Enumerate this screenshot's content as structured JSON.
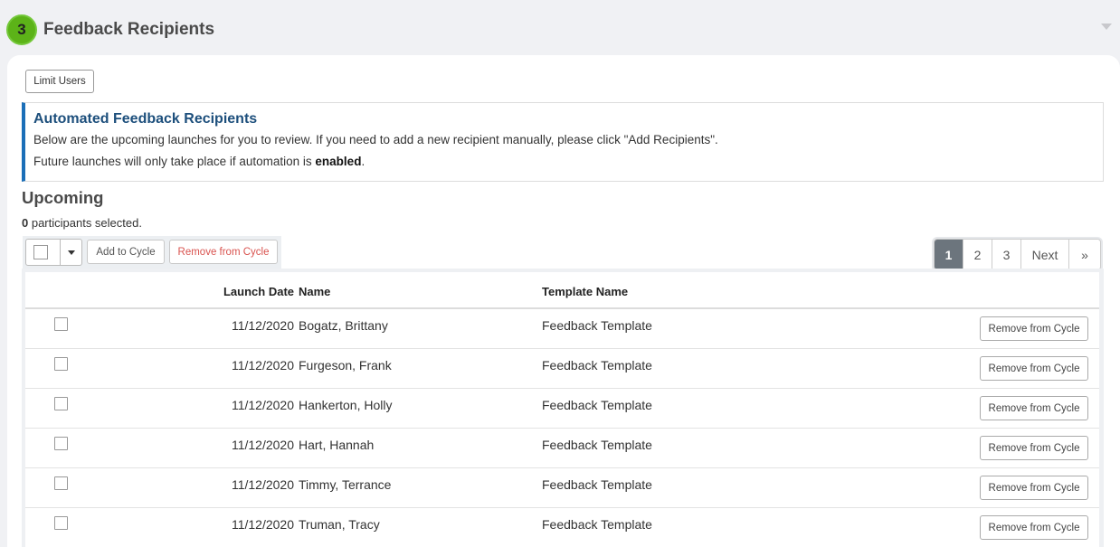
{
  "section": {
    "step": "3",
    "title": "Feedback Recipients"
  },
  "limit_users_label": "Limit Users",
  "info": {
    "title": "Automated Feedback Recipients",
    "line1": "Below are the upcoming launches for you to review. If you need to add a new recipient manually, please click \"Add Recipients\".",
    "line2_prefix": "Future launches will only take place if automation is ",
    "line2_bold": "enabled",
    "line2_suffix": "."
  },
  "upcoming": {
    "heading": "Upcoming",
    "selected_count": "0",
    "selected_text": " participants selected."
  },
  "toolbar": {
    "add_label": "Add to Cycle",
    "remove_label": "Remove from Cycle"
  },
  "pagination": {
    "pages": [
      "1",
      "2",
      "3"
    ],
    "active_page": "1",
    "next_label": "Next",
    "last_label": "»"
  },
  "table": {
    "columns": {
      "launch_date": "Launch Date",
      "name": "Name",
      "template": "Template Name"
    },
    "row_action_label": "Remove from Cycle",
    "rows": [
      {
        "date": "11/12/2020",
        "name": "Bogatz, Brittany",
        "template": "Feedback Template"
      },
      {
        "date": "11/12/2020",
        "name": "Furgeson, Frank",
        "template": "Feedback Template"
      },
      {
        "date": "11/12/2020",
        "name": "Hankerton, Holly",
        "template": "Feedback Template"
      },
      {
        "date": "11/12/2020",
        "name": "Hart, Hannah",
        "template": "Feedback Template"
      },
      {
        "date": "11/12/2020",
        "name": "Timmy, Terrance",
        "template": "Feedback Template"
      },
      {
        "date": "11/12/2020",
        "name": "Truman, Tracy",
        "template": "Feedback Template"
      }
    ]
  },
  "colors": {
    "step_green": "#5cb318",
    "info_accent": "#1b6fb8",
    "info_title": "#1d4f7c",
    "danger": "#d9534f",
    "page_active": "#6c757d"
  }
}
